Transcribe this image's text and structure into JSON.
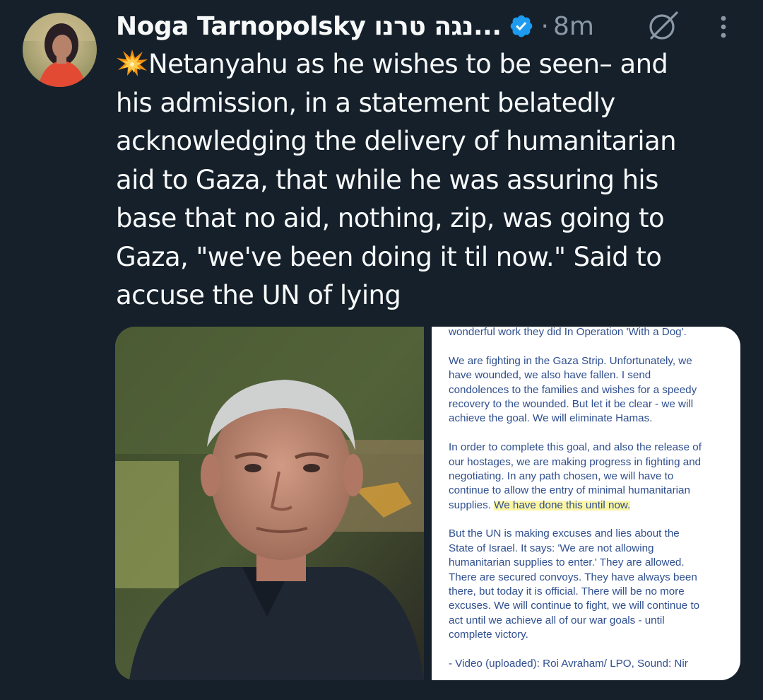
{
  "author": {
    "display_name": "Noga Tarnopolsky נגה טרנו...",
    "verified": true,
    "avatar": "avatar-photo"
  },
  "meta": {
    "separator": "·",
    "time_ago": "8m"
  },
  "icons": {
    "grok": "grok-icon",
    "more": "more-options-icon",
    "sparkle": "collision-emoji-icon",
    "verified": "verified-badge-icon"
  },
  "colors": {
    "background": "#15202b",
    "text": "#f7f9f9",
    "muted": "#8b98a5",
    "verified_blue": "#1d9bf0",
    "doc_text": "#2f4f8f",
    "highlight": "#fbf5a4"
  },
  "tweet": {
    "lines": [
      "Netanyahu as he wishes to be seen– and",
      "his admission, in a statement belatedly",
      "acknowledging the delivery of humanitarian",
      "aid to Gaza, that while he was assuring his",
      "base that no aid, nothing, zip, was going to",
      "Gaza, \"we've been doing it til now.\" Said to",
      "accuse the UN of lying"
    ]
  },
  "media": {
    "photo": "portrait-photo",
    "document": {
      "paragraphs": [
        [
          "wonderful work they did In Operation 'With a Dog'."
        ],
        [
          "We are fighting in the Gaza Strip. Unfortunately, we",
          "have wounded, we also have fallen. I send",
          "condolences to the families and wishes for a speedy",
          "recovery to the wounded. But let it be clear - we will",
          "achieve the goal. We will eliminate Hamas."
        ],
        [
          "In order to complete this goal, and also the release of",
          "our hostages, we are making progress in fighting and",
          "negotiating. In any path chosen, we will have to",
          "continue to allow the entry of minimal humanitarian"
        ],
        [
          "But the UN is making excuses and lies about the",
          "State of Israel. It says: 'We are not allowing",
          "humanitarian supplies to enter.' They are allowed.",
          "There are secured convoys. They have always been",
          "there, but today it is official. There will be no more",
          "excuses. We will continue to fight, we will continue to",
          "act until we achieve all of our war goals - until",
          "complete victory."
        ],
        [
          "- Video (uploaded): Roi Avraham/ LPO, Sound: Nir"
        ]
      ],
      "highlight_line_prefix": "supplies. ",
      "highlight_line_marked": "We have done this until now."
    }
  }
}
